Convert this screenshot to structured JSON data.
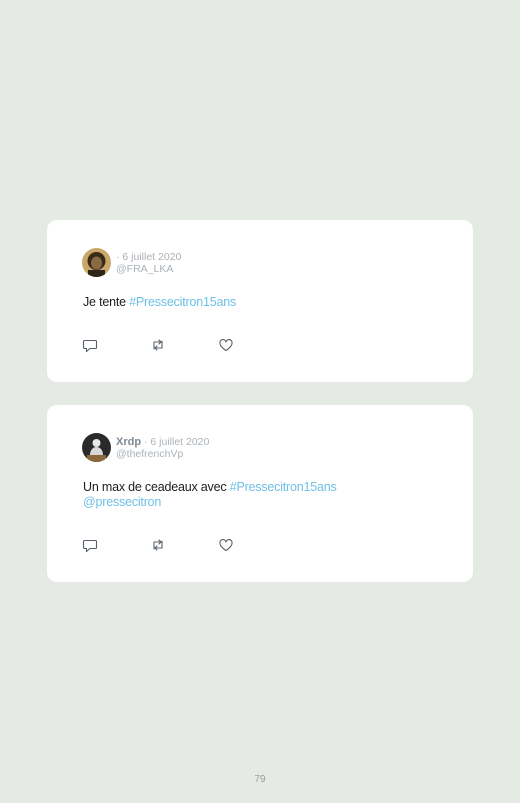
{
  "tweets": [
    {
      "name": "",
      "date": "· 6 juillet 2020",
      "handle": "@FRA_LKA",
      "text": "Je tente ",
      "hashtag": "#Pressecitron15ans",
      "mention": ""
    },
    {
      "name": "Xrdp",
      "date": " · 6 juillet 2020",
      "handle": "@thefrenchVp",
      "text": "Un max de ceadeaux avec ",
      "hashtag": "#Pressecitron15ans",
      "mention": "@pressecitron"
    }
  ],
  "actions": {
    "reply_icon": "reply-icon",
    "retweet_icon": "retweet-icon",
    "like_icon": "heart-icon"
  },
  "colors": {
    "background": "#e6eae4",
    "card": "#ffffff",
    "link": "#6ec0e6",
    "muted": "#aab2b8"
  },
  "page": {
    "number": "79"
  }
}
